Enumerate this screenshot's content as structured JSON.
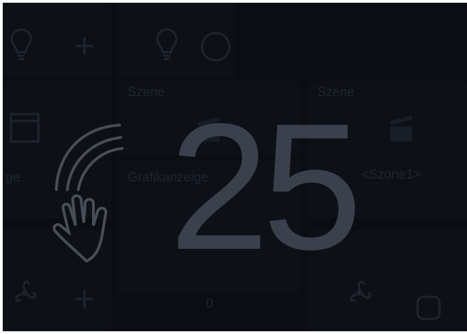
{
  "tiles": {
    "scene_left": "Szene",
    "scene_right": "Szene",
    "graphic_display": "Grafikanzeige",
    "graphic_display_partial": "ge",
    "zone_label": "<Szone1>",
    "bottom_value": "0"
  },
  "overlay": {
    "countdown": "25",
    "gesture_icon": "wave-hand-icon"
  },
  "colors": {
    "screen_bg": "#0a0d12",
    "tile_bg": "#0d1117",
    "dim_text": "#1e2530",
    "overlay_text": "#3a414d"
  }
}
